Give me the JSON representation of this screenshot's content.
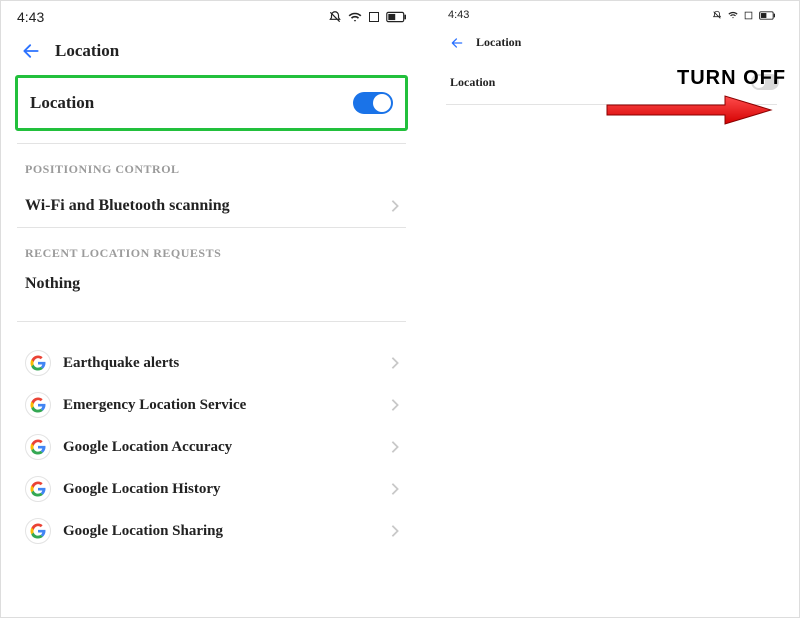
{
  "left": {
    "time": "4:43",
    "header_title": "Location",
    "location_label": "Location",
    "section_positioning": "Positioning Control",
    "wifi_bt_scanning": "Wi-Fi and Bluetooth scanning",
    "section_recent": "Recent Location Requests",
    "recent_nothing": "Nothing",
    "google_items": [
      {
        "label": "Earthquake alerts"
      },
      {
        "label": "Emergency Location Service"
      },
      {
        "label": "Google Location Accuracy"
      },
      {
        "label": "Google Location History"
      },
      {
        "label": "Google Location Sharing"
      }
    ]
  },
  "right": {
    "time": "4:43",
    "header_title": "Location",
    "location_label": "Location"
  },
  "annotation": {
    "turn_off": "TURN OFF"
  },
  "colors": {
    "highlight": "#22c03c",
    "toggle_on": "#1a73e8",
    "arrow": "#ff0000"
  }
}
